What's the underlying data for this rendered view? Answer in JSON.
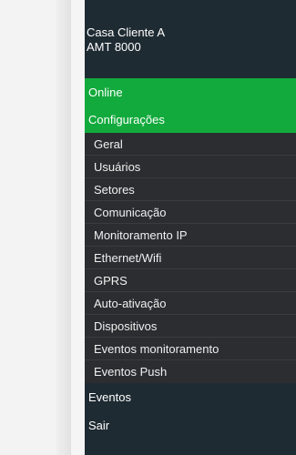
{
  "header": {
    "site_name": "Casa Cliente A",
    "device_model": "AMT 8000"
  },
  "menu": {
    "online": "Online",
    "configuracoes": "Configurações",
    "sub_items": [
      "Geral",
      "Usuários",
      "Setores",
      "Comunicação",
      "Monitoramento IP",
      "Ethernet/Wifi",
      "GPRS",
      "Auto-ativação",
      "Dispositivos",
      "Eventos monitoramento",
      "Eventos Push"
    ],
    "eventos": "Eventos",
    "sair": "Sair"
  },
  "colors": {
    "drawer_bg": "#1f2b33",
    "accent_green": "#12aa3c",
    "submenu_bg": "#2b2d30"
  }
}
